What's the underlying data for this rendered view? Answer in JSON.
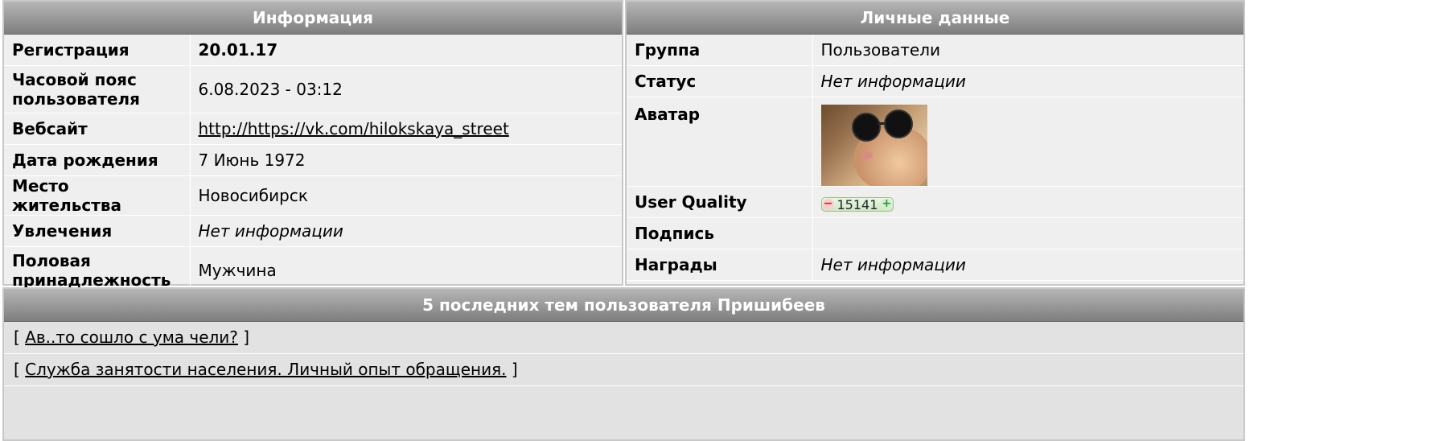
{
  "info_panel": {
    "title": "Информация",
    "rows": [
      {
        "label": "Регистрация",
        "value": "20.01.17"
      },
      {
        "label": "Часовой пояс пользователя",
        "value": "6.08.2023 - 03:12"
      },
      {
        "label": "Вебсайт",
        "value": "http://https://vk.com/hilokskaya_street"
      },
      {
        "label": "Дата рождения",
        "value": "7 Июнь 1972"
      },
      {
        "label": "Место жительства",
        "value": "Новосибирск"
      },
      {
        "label": "Увлечения",
        "value": "Нет информации"
      },
      {
        "label": "Половая принадлежность",
        "value": "Мужчина"
      }
    ]
  },
  "personal_panel": {
    "title": "Личные данные",
    "rows": [
      {
        "label": "Группа",
        "value": "Пользователи"
      },
      {
        "label": "Статус",
        "value": "Нет информации"
      },
      {
        "label": "Аватар",
        "value": ""
      },
      {
        "label": "User Quality",
        "value": "15141"
      },
      {
        "label": "Подпись",
        "value": ""
      },
      {
        "label": "Награды",
        "value": "Нет информации"
      }
    ],
    "avatar_icon": "cat-with-sunglasses-image",
    "uq_minus": "−",
    "uq_plus": "+"
  },
  "topics_panel": {
    "title": "5 последних тем пользователя Пришибеев",
    "bracket_open": "[",
    "bracket_close": "]",
    "topics": [
      "Ав..то сошло с ума чели?",
      "Служба занятости населения. Личный опыт обращения."
    ]
  },
  "colors": {
    "header_top": "#b6b6b6",
    "header_bottom": "#7e7e7e",
    "panel_bg": "#efefef",
    "uq_bg": "#d9f0cf"
  }
}
